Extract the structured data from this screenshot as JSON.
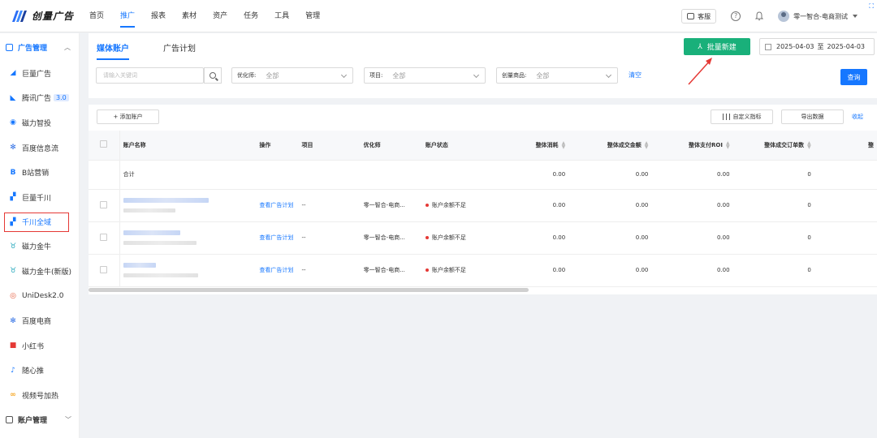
{
  "topbar": {
    "logo_text": "创量广告",
    "nav": [
      "首页",
      "推广",
      "报表",
      "素材",
      "资产",
      "任务",
      "工具",
      "管理"
    ],
    "active_nav": 1,
    "service_label": "客服",
    "help_symbol": "?",
    "user_name": "零一智合-电商测试",
    "corner_glyph": "⛶"
  },
  "sidebar": {
    "section_title": "广告管理",
    "section_chevron": "︿",
    "items": [
      {
        "label": "巨量广告",
        "icon": "ocean-engine-icon",
        "glyph": "◢",
        "color": "#1677ff"
      },
      {
        "label": "腾讯广告",
        "badge": "3.0",
        "icon": "tencent-ads-icon",
        "glyph": "◣",
        "color": "#1677ff"
      },
      {
        "label": "磁力智投",
        "icon": "kuaishou-icon",
        "glyph": "◉",
        "color": "#1677ff"
      },
      {
        "label": "百度信息流",
        "icon": "baidu-paw-icon",
        "glyph": "✻",
        "color": "#2f6fe4"
      },
      {
        "label": "B站营销",
        "icon": "bilibili-icon",
        "glyph": "B",
        "color": "#1677ff"
      },
      {
        "label": "巨量千川",
        "icon": "qianchuan-icon",
        "glyph": "▞",
        "color": "#1677ff"
      },
      {
        "label": "千川全域",
        "icon": "qianchuan-global-icon",
        "glyph": "▞",
        "color": "#1677ff",
        "active": true
      },
      {
        "label": "磁力金牛",
        "icon": "cili-jinniu-icon",
        "glyph": "♉",
        "color": "#1aa3b8"
      },
      {
        "label": "磁力金牛(新版)",
        "icon": "cili-jinniu-new-icon",
        "glyph": "♉",
        "color": "#1aa3b8"
      },
      {
        "label": "UniDesk2.0",
        "icon": "unidesk-icon",
        "glyph": "◎",
        "color": "#e55b3c"
      },
      {
        "label": "百度电商",
        "icon": "baidu-ecommerce-icon",
        "glyph": "✻",
        "color": "#2f6fe4"
      },
      {
        "label": "小红书",
        "icon": "xiaohongshu-icon",
        "glyph": "■",
        "color": "#e53935"
      },
      {
        "label": "随心推",
        "icon": "suixintui-icon",
        "glyph": "♪",
        "color": "#1677ff"
      },
      {
        "label": "视频号加热",
        "icon": "video-channel-icon",
        "glyph": "∞",
        "color": "#f5a623"
      }
    ],
    "footer_title": "账户管理",
    "footer_chevron": "﹀"
  },
  "tabs": {
    "media": "媒体账户",
    "plan": "广告计划"
  },
  "batch_button": "批量新建",
  "date_range": {
    "start": "2025-04-03",
    "separator": "至",
    "end": "2025-04-03"
  },
  "filters": {
    "search_placeholder": "请输入关键词",
    "optimizer_label": "优化师:",
    "optimizer_value": "全部",
    "project_label": "项目:",
    "project_value": "全部",
    "product_label": "创量商品:",
    "product_value": "全部",
    "clear_label": "清空",
    "query_label": "查询"
  },
  "table_toolbar": {
    "add_account": "+ 添加账户",
    "custom_metrics": "自定义指标",
    "export": "导出数据",
    "collapse": "收起"
  },
  "table": {
    "headers": [
      "账户名称",
      "操作",
      "项目",
      "优化师",
      "账户状态",
      "整体消耗",
      "整体成交金额",
      "整体支付ROI",
      "整体成交订单数",
      "整"
    ],
    "total_row": {
      "label": "合计",
      "values": [
        "0.00",
        "0.00",
        "0.00",
        "0"
      ]
    },
    "rows": [
      {
        "action": "查看广告计划",
        "project": "--",
        "optimizer": "零一智合-电商...",
        "status": "账户余额不足",
        "values": [
          "0.00",
          "0.00",
          "0.00",
          "0"
        ]
      },
      {
        "action": "查看广告计划",
        "project": "--",
        "optimizer": "零一智合-电商...",
        "status": "账户余额不足",
        "values": [
          "0.00",
          "0.00",
          "0.00",
          "0"
        ]
      },
      {
        "action": "查看广告计划",
        "project": "--",
        "optimizer": "零一智合-电商...",
        "status": "账户余额不足",
        "values": [
          "0.00",
          "0.00",
          "0.00",
          "0"
        ]
      }
    ]
  },
  "colors": {
    "primary": "#1677ff",
    "batch_green": "#19b07a",
    "alert_red": "#e53935"
  }
}
